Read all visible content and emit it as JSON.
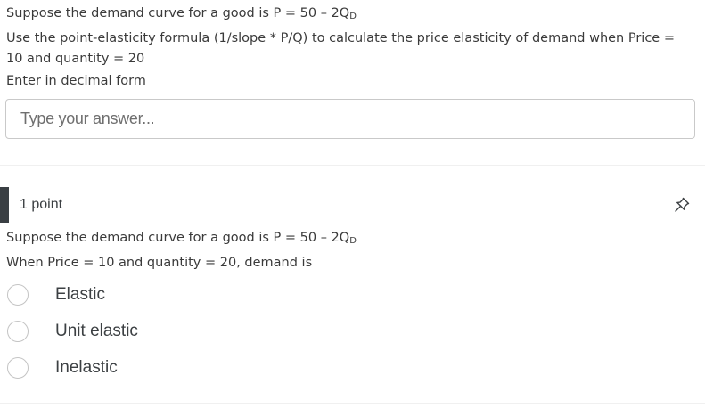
{
  "question1": {
    "line1_prefix": "Suppose the demand curve for a good is P = 50 – 2Q",
    "line1_subscript": "D",
    "line2": "Use the point-elasticity formula (1/slope * P/Q) to calculate the price elasticity of demand when Price =",
    "line3": "10 and quantity = 20",
    "line4": "Enter in decimal form",
    "answer_placeholder": "Type your answer...",
    "answer_value": ""
  },
  "question2": {
    "points": "1 point",
    "line1_prefix": "Suppose the demand curve for a good is P = 50 – 2Q",
    "line1_subscript": "D",
    "line2": "When Price = 10 and quantity = 20, demand is",
    "options": [
      {
        "label": "Elastic",
        "selected": false
      },
      {
        "label": "Unit elastic",
        "selected": false
      },
      {
        "label": "Inelastic",
        "selected": false
      }
    ]
  },
  "icons": {
    "pin": "pin-icon"
  }
}
